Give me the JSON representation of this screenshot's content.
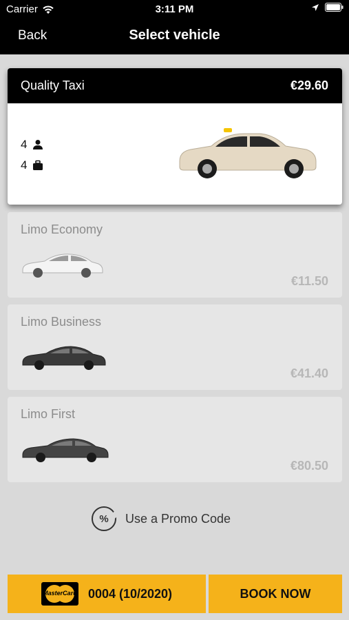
{
  "status_bar": {
    "carrier": "Carrier",
    "time": "3:11 PM"
  },
  "nav": {
    "back_label": "Back",
    "title": "Select vehicle"
  },
  "selected_vehicle": {
    "name": "Quality Taxi",
    "price": "€29.60",
    "passengers": "4",
    "luggage": "4"
  },
  "vehicles": [
    {
      "name": "Limo Economy",
      "price": "€11.50"
    },
    {
      "name": "Limo Business",
      "price": "€41.40"
    },
    {
      "name": "Limo First",
      "price": "€80.50"
    }
  ],
  "promo": {
    "label": "Use a Promo Code",
    "icon_symbol": "%"
  },
  "payment": {
    "card_brand": "MasterCard",
    "card_label": "0004 (10/2020)"
  },
  "book_label": "BOOK NOW",
  "colors": {
    "accent": "#f5b21a",
    "bar": "#000000",
    "background": "#d9d9d9"
  }
}
